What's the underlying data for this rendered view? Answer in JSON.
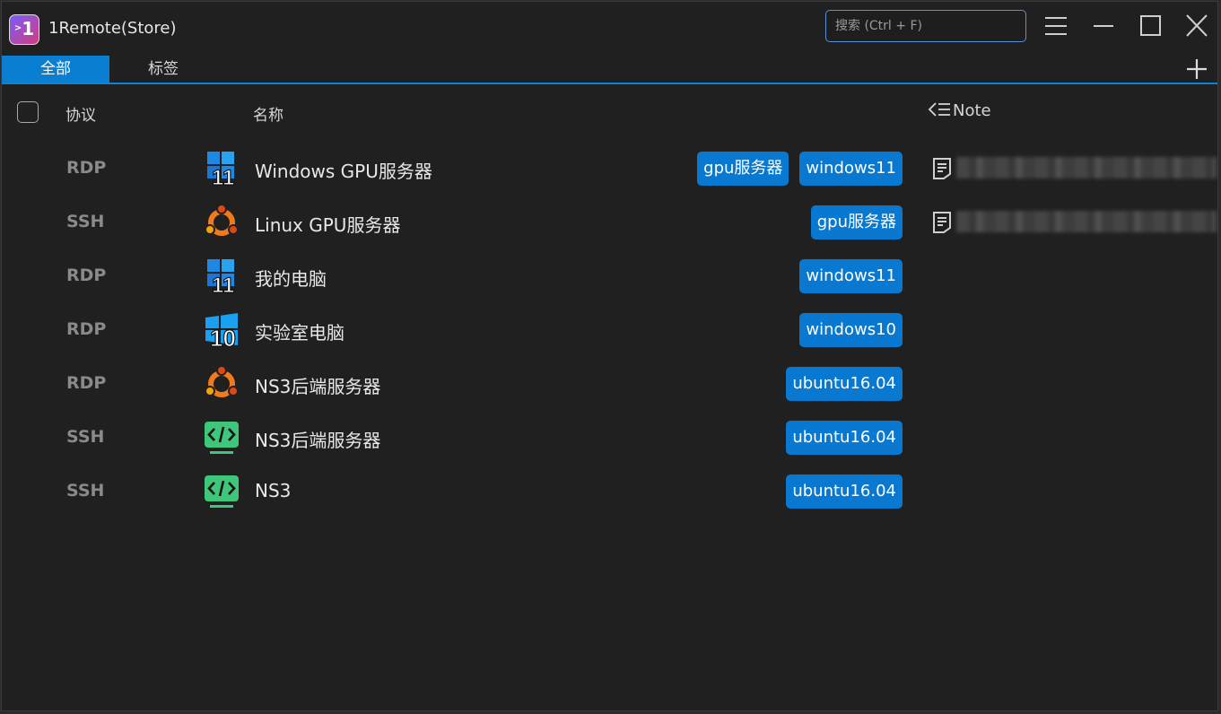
{
  "window": {
    "title": "1Remote(Store)",
    "app_icon_text": "1"
  },
  "search": {
    "placeholder": "搜索 (Ctrl + F)"
  },
  "tabs": [
    {
      "label": "全部"
    },
    {
      "label": "标签"
    }
  ],
  "header": {
    "protocol": "协议",
    "name": "名称",
    "note": "Note"
  },
  "rows": [
    {
      "protocol": "RDP",
      "icon": "windows11-icon",
      "name": "Windows GPU服务器",
      "tags": [
        "gpu服务器",
        "windows11"
      ],
      "has_note": true
    },
    {
      "protocol": "SSH",
      "icon": "ubuntu-icon",
      "name": "Linux GPU服务器",
      "tags": [
        "gpu服务器"
      ],
      "has_note": true
    },
    {
      "protocol": "RDP",
      "icon": "windows11-icon",
      "name": "我的电脑",
      "tags": [
        "windows11"
      ],
      "has_note": false
    },
    {
      "protocol": "RDP",
      "icon": "windows10-icon",
      "name": "实验室电脑",
      "tags": [
        "windows10"
      ],
      "has_note": false
    },
    {
      "protocol": "RDP",
      "icon": "ubuntu-icon",
      "name": "NS3后端服务器",
      "tags": [
        "ubuntu16.04"
      ],
      "has_note": false
    },
    {
      "protocol": "SSH",
      "icon": "code-terminal-icon",
      "name": "NS3后端服务器",
      "tags": [
        "ubuntu16.04"
      ],
      "has_note": false
    },
    {
      "protocol": "SSH",
      "icon": "code-terminal-icon",
      "name": "NS3",
      "tags": [
        "ubuntu16.04"
      ],
      "has_note": false
    }
  ],
  "colors": {
    "accent": "#0a7ed1",
    "tag": "#0878d0",
    "background": "#202020",
    "protocol_text": "#8a8a8a"
  }
}
